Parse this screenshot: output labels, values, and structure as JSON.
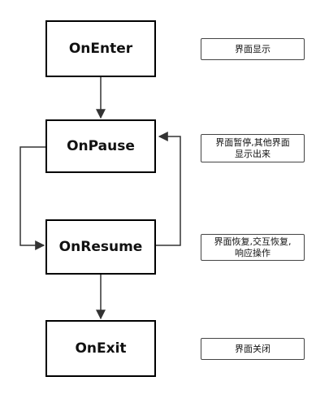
{
  "states": {
    "enter": "OnEnter",
    "pause": "OnPause",
    "resume": "OnResume",
    "exit": "OnExit"
  },
  "notes": {
    "enter": "界面显示",
    "pause": "界面暂停,其他界面\n显示出来",
    "resume": "界面恢复,交互恢复,\n响应操作",
    "exit": "界面关闭"
  },
  "colors": {
    "line": "#333333",
    "box_border": "#000000",
    "text": "#111111"
  }
}
